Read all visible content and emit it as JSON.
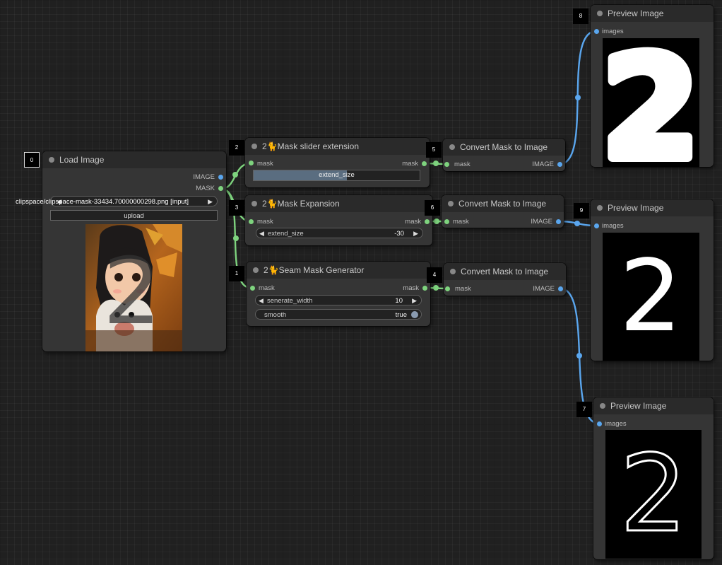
{
  "nodes": {
    "load_image": {
      "id": "0",
      "title": "Load Image",
      "outputs": [
        "IMAGE",
        "MASK"
      ],
      "file_value": "clipspace/clipspace-mask-33434.70000000298.png [input]",
      "upload_label": "upload",
      "preview_glyph": "2"
    },
    "mask_slider": {
      "id": "2",
      "title": "2🐈Mask slider extension",
      "input": "mask",
      "output": "mask",
      "widget_label": "extend_size"
    },
    "mask_expansion": {
      "id": "3",
      "title": "2🐈Mask Expansion",
      "input": "mask",
      "output": "mask",
      "widget_label": "extend_size",
      "widget_value": "-30"
    },
    "seam_mask": {
      "id": "1",
      "title": "2🐈Seam Mask Generator",
      "input": "mask",
      "output": "mask",
      "widget1_label": "senerate_width",
      "widget1_value": "10",
      "widget2_label": "smooth",
      "widget2_value": "true"
    },
    "convert5": {
      "id": "5",
      "title": "Convert Mask to Image",
      "input": "mask",
      "output": "IMAGE"
    },
    "convert6": {
      "id": "6",
      "title": "Convert Mask to Image",
      "input": "mask",
      "output": "IMAGE"
    },
    "convert4": {
      "id": "4",
      "title": "Convert Mask to Image",
      "input": "mask",
      "output": "IMAGE"
    },
    "preview8": {
      "id": "8",
      "title": "Preview Image",
      "input": "images",
      "glyph": "2"
    },
    "preview9": {
      "id": "9",
      "title": "Preview Image",
      "input": "images",
      "glyph": "2"
    },
    "preview7": {
      "id": "7",
      "title": "Preview Image",
      "input": "images",
      "glyph": "2"
    }
  },
  "colors": {
    "mask_wire": "#7ed37e",
    "image_wire": "#5aa6ee",
    "node_body": "#353535",
    "node_header": "#2a2a2a"
  }
}
